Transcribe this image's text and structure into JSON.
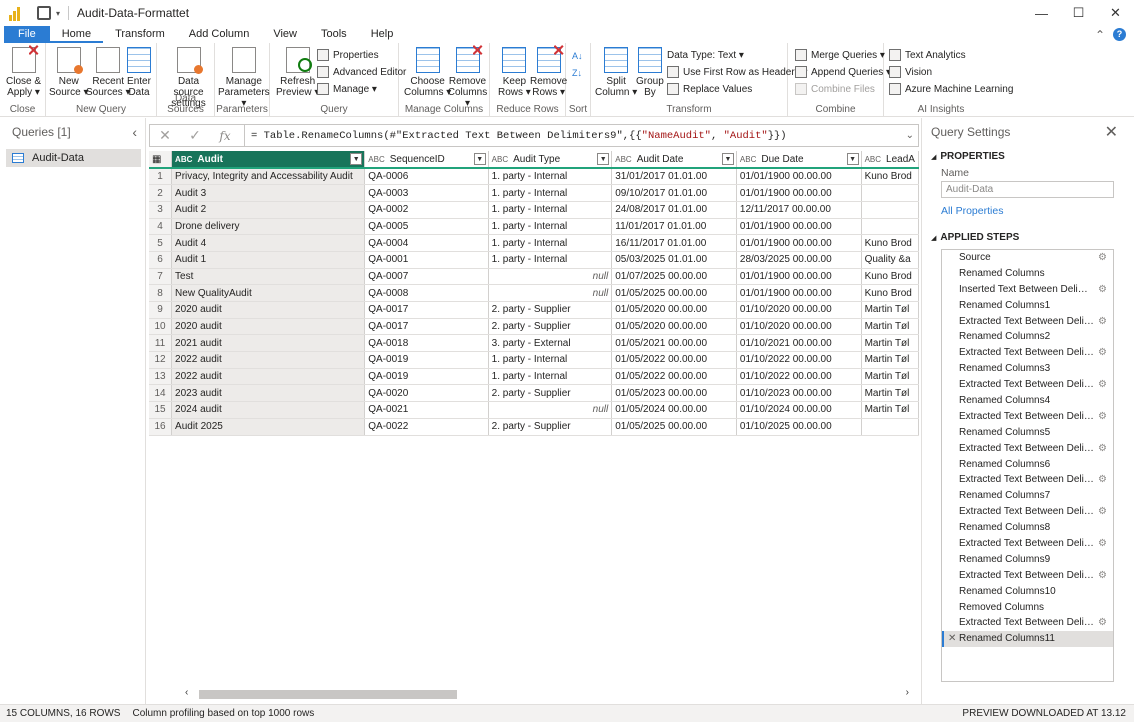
{
  "window": {
    "title": "Audit-Data-Formattet",
    "minimize": "—",
    "maximize": "☐",
    "close": "✕"
  },
  "menu": {
    "tabs": [
      "File",
      "Home",
      "Transform",
      "Add Column",
      "View",
      "Tools",
      "Help"
    ],
    "collapse": "⌃",
    "help": "?"
  },
  "ribbon": {
    "close_group": "Close",
    "close_apply": "Close &",
    "close_apply2": "Apply ▾",
    "new_query_group": "New Query",
    "new_source": "New",
    "new_source2": "Source ▾",
    "recent_sources": "Recent",
    "recent_sources2": "Sources ▾",
    "enter_data": "Enter",
    "enter_data2": "Data",
    "data_sources_group": "Data Sources",
    "data_source_settings": "Data source",
    "data_source_settings2": "settings",
    "parameters_group": "Parameters",
    "manage_parameters": "Manage",
    "manage_parameters2": "Parameters ▾",
    "query_group": "Query",
    "refresh_preview": "Refresh",
    "refresh_preview2": "Preview ▾",
    "properties": "Properties",
    "advanced_editor": "Advanced Editor",
    "manage": "Manage ▾",
    "manage_columns_group": "Manage Columns",
    "choose_columns": "Choose",
    "choose_columns2": "Columns ▾",
    "remove_columns": "Remove",
    "remove_columns2": "Columns ▾",
    "reduce_rows_group": "Reduce Rows",
    "keep_rows": "Keep",
    "keep_rows2": "Rows ▾",
    "remove_rows": "Remove",
    "remove_rows2": "Rows ▾",
    "sort_group": "Sort",
    "transform_group": "Transform",
    "split_column": "Split",
    "split_column2": "Column ▾",
    "group_by": "Group",
    "group_by2": "By",
    "data_type": "Data Type: Text ▾",
    "first_row_headers": "Use First Row as Headers ▾",
    "replace_values": "Replace Values",
    "combine_group": "Combine",
    "merge_queries": "Merge Queries ▾",
    "append_queries": "Append Queries ▾",
    "combine_files": "Combine Files",
    "ai_group": "AI Insights",
    "text_analytics": "Text Analytics",
    "vision": "Vision",
    "azure_ml": "Azure Machine Learning"
  },
  "queries": {
    "header": "Queries [1]",
    "collapse": "‹",
    "items": [
      "Audit-Data"
    ]
  },
  "formula": {
    "cancel": "✕",
    "commit": "✓",
    "fx": "fx",
    "prefix": "= Table.RenameColumns(#\"Extracted Text Between Delimiters9\",{{",
    "str1": "\"NameAudit\"",
    "mid": ", ",
    "str2": "\"Audit\"",
    "suffix": "}})",
    "expand": "⌄"
  },
  "grid": {
    "columns": [
      {
        "type": "ABC",
        "name": "Audit"
      },
      {
        "type": "ABC",
        "name": "SequenceID"
      },
      {
        "type": "ABC",
        "name": "Audit Type"
      },
      {
        "type": "ABC",
        "name": "Audit Date"
      },
      {
        "type": "ABC",
        "name": "Due Date"
      },
      {
        "type": "ABC",
        "name": "LeadA"
      }
    ],
    "rows": [
      [
        "1",
        "Privacy, Integrity and Accessability Audit",
        "QA-0006",
        "1. party - Internal",
        "31/01/2017 01.01.00",
        "01/01/1900 00.00.00",
        "Kuno Brod"
      ],
      [
        "2",
        "Audit 3",
        "QA-0003",
        "1. party - Internal",
        "09/10/2017 01.01.00",
        "01/01/1900 00.00.00",
        ""
      ],
      [
        "3",
        "Audit 2",
        "QA-0002",
        "1. party - Internal",
        "24/08/2017 01.01.00",
        "12/11/2017 00.00.00",
        ""
      ],
      [
        "4",
        "Drone delivery",
        "QA-0005",
        "1. party - Internal",
        "11/01/2017 01.01.00",
        "01/01/1900 00.00.00",
        ""
      ],
      [
        "5",
        "Audit 4",
        "QA-0004",
        "1. party - Internal",
        "16/11/2017 01.01.00",
        "01/01/1900 00.00.00",
        "Kuno Brod"
      ],
      [
        "6",
        "Audit 1",
        "QA-0001",
        "1. party - Internal",
        "05/03/2025 01.01.00",
        "28/03/2025 00.00.00",
        "Quality &a"
      ],
      [
        "7",
        "Test",
        "QA-0007",
        "null",
        "01/07/2025 00.00.00",
        "01/01/1900 00.00.00",
        "Kuno Brod"
      ],
      [
        "8",
        "New QualityAudit",
        "QA-0008",
        "null",
        "01/05/2025 00.00.00",
        "01/01/1900 00.00.00",
        "Kuno Brod"
      ],
      [
        "9",
        "2020 audit",
        "QA-0017",
        "2. party - Supplier",
        "01/05/2020 00.00.00",
        "01/10/2020 00.00.00",
        "Martin Tøl"
      ],
      [
        "10",
        "2020 audit",
        "QA-0017",
        "2. party - Supplier",
        "01/05/2020 00.00.00",
        "01/10/2020 00.00.00",
        "Martin Tøl"
      ],
      [
        "11",
        "2021 audit",
        "QA-0018",
        "3. party - External",
        "01/05/2021 00.00.00",
        "01/10/2021 00.00.00",
        "Martin Tøl"
      ],
      [
        "12",
        "2022 audit",
        "QA-0019",
        "1. party - Internal",
        "01/05/2022 00.00.00",
        "01/10/2022 00.00.00",
        "Martin Tøl"
      ],
      [
        "13",
        "2022 audit",
        "QA-0019",
        "1. party - Internal",
        "01/05/2022 00.00.00",
        "01/10/2022 00.00.00",
        "Martin Tøl"
      ],
      [
        "14",
        "2023 audit",
        "QA-0020",
        "2. party - Supplier",
        "01/05/2023 00.00.00",
        "01/10/2023 00.00.00",
        "Martin Tøl"
      ],
      [
        "15",
        "2024 audit",
        "QA-0021",
        "null",
        "01/05/2024 00.00.00",
        "01/10/2024 00.00.00",
        "Martin Tøl"
      ],
      [
        "16",
        "Audit 2025",
        "QA-0022",
        "2. party - Supplier",
        "01/05/2025 00.00.00",
        "01/10/2025 00.00.00",
        ""
      ]
    ],
    "scroll_left": "‹",
    "scroll_right": "›"
  },
  "settings": {
    "title": "Query Settings",
    "close": "✕",
    "properties_header": "PROPERTIES",
    "name_label": "Name",
    "name_value": "Audit-Data",
    "all_properties": "All Properties",
    "applied_steps_header": "APPLIED STEPS",
    "steps": [
      {
        "label": "Source",
        "gear": true
      },
      {
        "label": "Renamed Columns",
        "gear": false
      },
      {
        "label": "Inserted Text Between Delimit...",
        "gear": true
      },
      {
        "label": "Renamed Columns1",
        "gear": false
      },
      {
        "label": "Extracted Text Between Delim...",
        "gear": true
      },
      {
        "label": "Renamed Columns2",
        "gear": false
      },
      {
        "label": "Extracted Text Between Delim...",
        "gear": true
      },
      {
        "label": "Renamed Columns3",
        "gear": false
      },
      {
        "label": "Extracted Text Between Delim...",
        "gear": true
      },
      {
        "label": "Renamed Columns4",
        "gear": false
      },
      {
        "label": "Extracted Text Between Delim...",
        "gear": true
      },
      {
        "label": "Renamed Columns5",
        "gear": false
      },
      {
        "label": "Extracted Text Between Delim...",
        "gear": true
      },
      {
        "label": "Renamed Columns6",
        "gear": false
      },
      {
        "label": "Extracted Text Between Delim...",
        "gear": true
      },
      {
        "label": "Renamed Columns7",
        "gear": false
      },
      {
        "label": "Extracted Text Between Delim...",
        "gear": true
      },
      {
        "label": "Renamed Columns8",
        "gear": false
      },
      {
        "label": "Extracted Text Between Delim...",
        "gear": true
      },
      {
        "label": "Renamed Columns9",
        "gear": false
      },
      {
        "label": "Extracted Text Between Delim...",
        "gear": true
      },
      {
        "label": "Renamed Columns10",
        "gear": false
      },
      {
        "label": "Removed Columns",
        "gear": false
      },
      {
        "label": "Extracted Text Between Delim...",
        "gear": true
      },
      {
        "label": "Renamed Columns11",
        "gear": false,
        "active": true
      }
    ],
    "gear": "⚙",
    "delete_step": "✕"
  },
  "status": {
    "counts": "15 COLUMNS, 16 ROWS",
    "profiling": "Column profiling based on top 1000 rows",
    "preview": "PREVIEW DOWNLOADED AT 13.12"
  },
  "colors": {
    "accent": "#2b7cd3",
    "selected_column": "#18745a",
    "column_quality_bar": "#21a37b"
  }
}
